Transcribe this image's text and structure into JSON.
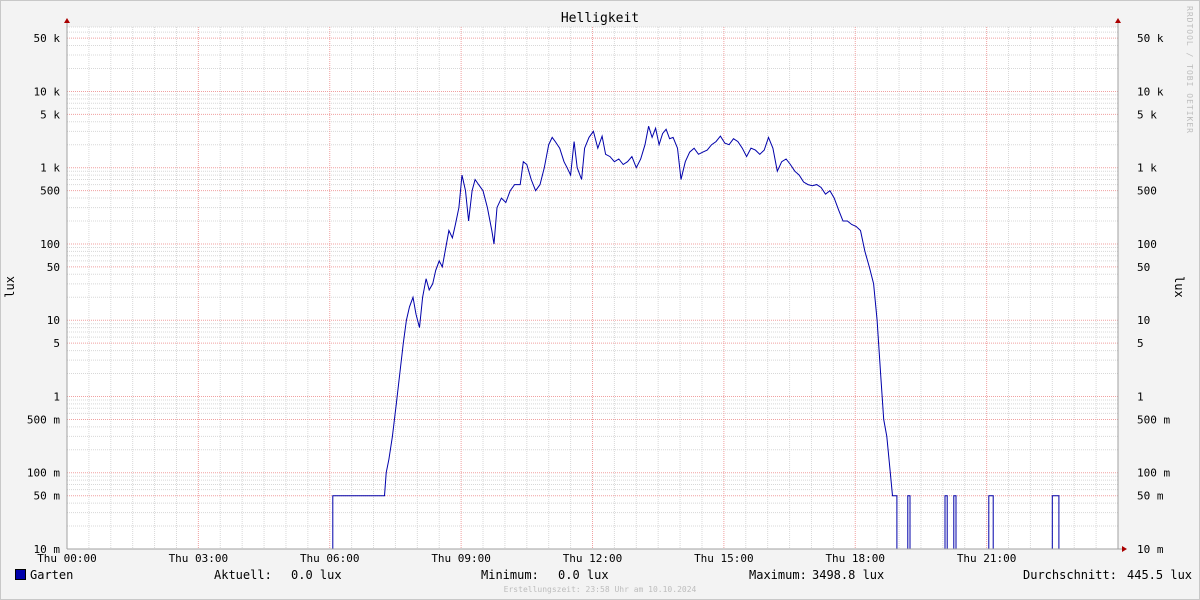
{
  "title": "Helligkeit",
  "watermark": "RRDTOOL / TOBI OETIKER",
  "ylabel": "lux",
  "legend": {
    "series_name": "Garten",
    "current_label": "Aktuell:",
    "current_value": "0.0 lux",
    "min_label": "Minimum:",
    "min_value": "0.0 lux",
    "max_label": "Maximum:",
    "max_value": "3498.8 lux",
    "avg_label": "Durchschnitt:",
    "avg_value": "445.5 lux"
  },
  "footer": "Erstellungszeit: 23:58 Uhr am 10.10.2024",
  "colors": {
    "line": "#0000aa",
    "major_grid": "#f0a0a0",
    "minor_grid": "#d8d8d8",
    "axis": "#a0a0a0",
    "background": "#ffffff",
    "canvas": "#f3f3f3"
  },
  "chart_data": {
    "type": "line",
    "title": "Helligkeit",
    "xlabel": "",
    "ylabel": "lux",
    "y_scale": "log",
    "ylim": [
      0.01,
      70000
    ],
    "xlim": [
      0,
      24
    ],
    "x_ticks": [
      {
        "x": 0,
        "label": "Thu 00:00"
      },
      {
        "x": 3,
        "label": "Thu 03:00"
      },
      {
        "x": 6,
        "label": "Thu 06:00"
      },
      {
        "x": 9,
        "label": "Thu 09:00"
      },
      {
        "x": 12,
        "label": "Thu 12:00"
      },
      {
        "x": 15,
        "label": "Thu 15:00"
      },
      {
        "x": 18,
        "label": "Thu 18:00"
      },
      {
        "x": 21,
        "label": "Thu 21:00"
      }
    ],
    "y_ticks": [
      {
        "v": 50000,
        "label": "50 k"
      },
      {
        "v": 10000,
        "label": "10 k"
      },
      {
        "v": 5000,
        "label": "5 k"
      },
      {
        "v": 1000,
        "label": "1 k"
      },
      {
        "v": 500,
        "label": "500"
      },
      {
        "v": 100,
        "label": "100"
      },
      {
        "v": 50,
        "label": "50"
      },
      {
        "v": 10,
        "label": "10"
      },
      {
        "v": 5,
        "label": "5"
      },
      {
        "v": 1,
        "label": "1"
      },
      {
        "v": 0.5,
        "label": "500 m"
      },
      {
        "v": 0.1,
        "label": "100 m"
      },
      {
        "v": 0.05,
        "label": "50 m"
      },
      {
        "v": 0.01,
        "label": "10 m"
      }
    ],
    "grid": true,
    "series": [
      {
        "name": "Garten",
        "points": [
          [
            0.0,
            0.01
          ],
          [
            6.07,
            0.01
          ],
          [
            6.07,
            0.05
          ],
          [
            7.25,
            0.05
          ],
          [
            7.29,
            0.1
          ],
          [
            7.35,
            0.15
          ],
          [
            7.43,
            0.3
          ],
          [
            7.52,
            0.8
          ],
          [
            7.6,
            2
          ],
          [
            7.68,
            5
          ],
          [
            7.75,
            10
          ],
          [
            7.82,
            15
          ],
          [
            7.9,
            20
          ],
          [
            7.97,
            12
          ],
          [
            8.05,
            8
          ],
          [
            8.12,
            20
          ],
          [
            8.2,
            35
          ],
          [
            8.27,
            25
          ],
          [
            8.35,
            30
          ],
          [
            8.42,
            45
          ],
          [
            8.5,
            60
          ],
          [
            8.57,
            50
          ],
          [
            8.65,
            90
          ],
          [
            8.72,
            150
          ],
          [
            8.8,
            120
          ],
          [
            8.87,
            180
          ],
          [
            8.95,
            300
          ],
          [
            9.02,
            800
          ],
          [
            9.1,
            500
          ],
          [
            9.17,
            200
          ],
          [
            9.25,
            500
          ],
          [
            9.32,
            700
          ],
          [
            9.4,
            600
          ],
          [
            9.5,
            500
          ],
          [
            9.6,
            300
          ],
          [
            9.7,
            150
          ],
          [
            9.75,
            100
          ],
          [
            9.82,
            300
          ],
          [
            9.92,
            400
          ],
          [
            10.02,
            350
          ],
          [
            10.12,
            500
          ],
          [
            10.22,
            600
          ],
          [
            10.35,
            600
          ],
          [
            10.42,
            1200
          ],
          [
            10.5,
            1100
          ],
          [
            10.6,
            700
          ],
          [
            10.7,
            500
          ],
          [
            10.8,
            600
          ],
          [
            10.9,
            1000
          ],
          [
            11.0,
            2000
          ],
          [
            11.08,
            2500
          ],
          [
            11.15,
            2200
          ],
          [
            11.25,
            1800
          ],
          [
            11.35,
            1200
          ],
          [
            11.42,
            1000
          ],
          [
            11.5,
            800
          ],
          [
            11.58,
            2200
          ],
          [
            11.65,
            1000
          ],
          [
            11.75,
            700
          ],
          [
            11.82,
            1800
          ],
          [
            11.92,
            2500
          ],
          [
            12.02,
            3000
          ],
          [
            12.12,
            1800
          ],
          [
            12.22,
            2600
          ],
          [
            12.3,
            1500
          ],
          [
            12.4,
            1400
          ],
          [
            12.5,
            1200
          ],
          [
            12.6,
            1300
          ],
          [
            12.7,
            1100
          ],
          [
            12.8,
            1200
          ],
          [
            12.9,
            1400
          ],
          [
            13.0,
            1000
          ],
          [
            13.1,
            1300
          ],
          [
            13.2,
            2000
          ],
          [
            13.28,
            3500
          ],
          [
            13.36,
            2500
          ],
          [
            13.44,
            3300
          ],
          [
            13.52,
            2000
          ],
          [
            13.6,
            2800
          ],
          [
            13.68,
            3200
          ],
          [
            13.76,
            2400
          ],
          [
            13.84,
            2500
          ],
          [
            13.94,
            1800
          ],
          [
            14.02,
            700
          ],
          [
            14.12,
            1200
          ],
          [
            14.22,
            1600
          ],
          [
            14.32,
            1800
          ],
          [
            14.42,
            1500
          ],
          [
            14.52,
            1600
          ],
          [
            14.62,
            1700
          ],
          [
            14.72,
            2000
          ],
          [
            14.82,
            2200
          ],
          [
            14.92,
            2600
          ],
          [
            15.02,
            2100
          ],
          [
            15.12,
            2000
          ],
          [
            15.22,
            2400
          ],
          [
            15.32,
            2200
          ],
          [
            15.42,
            1800
          ],
          [
            15.52,
            1400
          ],
          [
            15.62,
            1800
          ],
          [
            15.72,
            1700
          ],
          [
            15.82,
            1500
          ],
          [
            15.92,
            1700
          ],
          [
            16.02,
            2500
          ],
          [
            16.12,
            1800
          ],
          [
            16.22,
            900
          ],
          [
            16.32,
            1200
          ],
          [
            16.42,
            1300
          ],
          [
            16.52,
            1100
          ],
          [
            16.62,
            900
          ],
          [
            16.72,
            800
          ],
          [
            16.82,
            650
          ],
          [
            16.92,
            600
          ],
          [
            17.02,
            580
          ],
          [
            17.12,
            600
          ],
          [
            17.22,
            550
          ],
          [
            17.32,
            450
          ],
          [
            17.42,
            500
          ],
          [
            17.52,
            400
          ],
          [
            17.62,
            280
          ],
          [
            17.72,
            200
          ],
          [
            17.82,
            200
          ],
          [
            17.92,
            180
          ],
          [
            18.02,
            170
          ],
          [
            18.12,
            150
          ],
          [
            18.22,
            80
          ],
          [
            18.32,
            50
          ],
          [
            18.42,
            30
          ],
          [
            18.5,
            10
          ],
          [
            18.58,
            2
          ],
          [
            18.65,
            0.5
          ],
          [
            18.72,
            0.3
          ],
          [
            18.8,
            0.1
          ],
          [
            18.85,
            0.05
          ],
          [
            18.95,
            0.05
          ],
          [
            18.95,
            0.01
          ],
          [
            19.2,
            0.01
          ],
          [
            19.2,
            0.05
          ],
          [
            19.25,
            0.05
          ],
          [
            19.25,
            0.01
          ],
          [
            20.05,
            0.01
          ],
          [
            20.05,
            0.05
          ],
          [
            20.1,
            0.05
          ],
          [
            20.1,
            0.01
          ],
          [
            20.25,
            0.01
          ],
          [
            20.25,
            0.05
          ],
          [
            20.3,
            0.05
          ],
          [
            20.3,
            0.01
          ],
          [
            21.05,
            0.01
          ],
          [
            21.05,
            0.05
          ],
          [
            21.15,
            0.05
          ],
          [
            21.15,
            0.01
          ],
          [
            22.5,
            0.01
          ],
          [
            22.5,
            0.05
          ],
          [
            22.65,
            0.05
          ],
          [
            22.65,
            0.01
          ],
          [
            24.0,
            0.01
          ]
        ]
      }
    ]
  }
}
